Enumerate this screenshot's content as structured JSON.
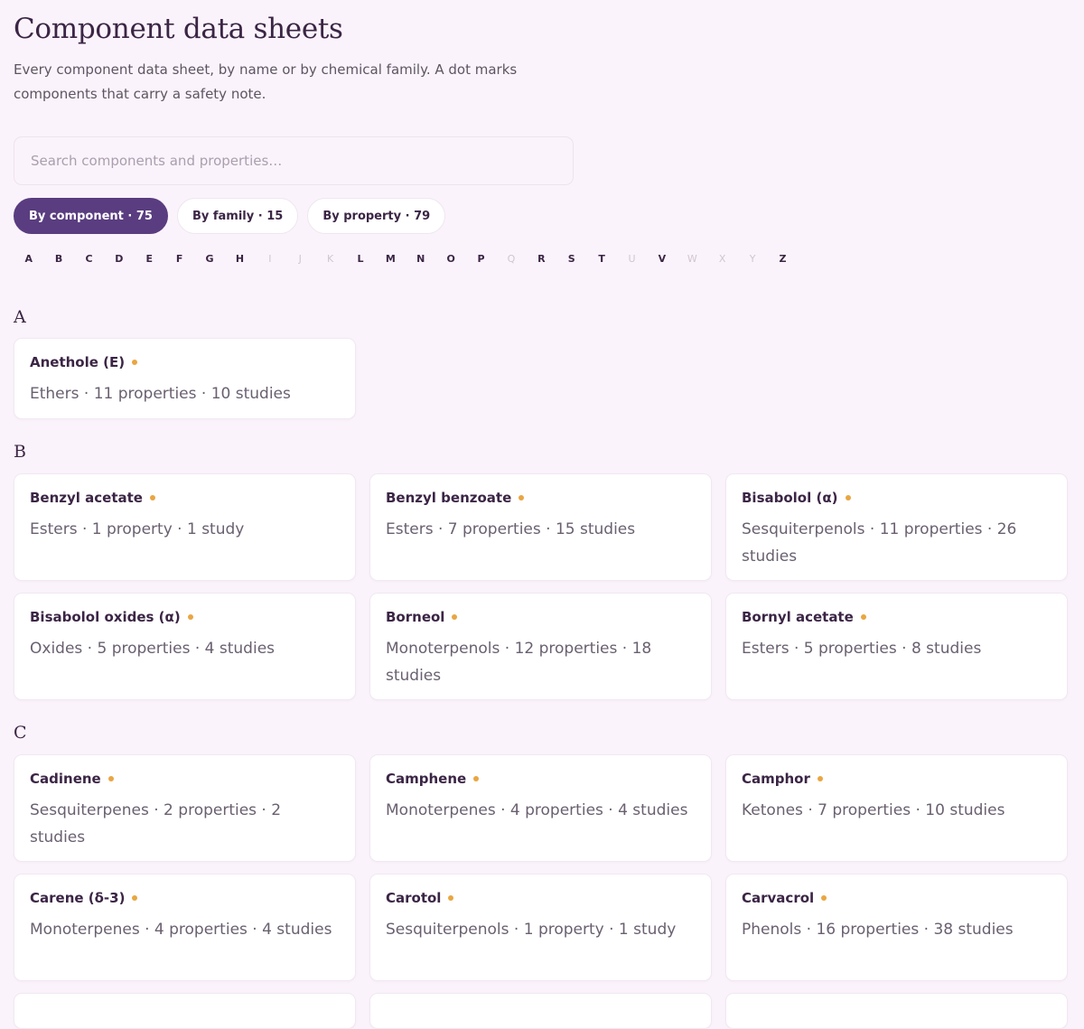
{
  "header": {
    "title": "Component data sheets",
    "subtitle": "Every component data sheet, by name or by chemical family. A dot marks components that carry a safety note."
  },
  "search": {
    "placeholder": "Search components and properties…"
  },
  "tabs": [
    {
      "label": "By component · 75",
      "active": true
    },
    {
      "label": "By family · 15",
      "active": false
    },
    {
      "label": "By property · 79",
      "active": false
    }
  ],
  "alphabet": [
    {
      "letter": "A",
      "enabled": true
    },
    {
      "letter": "B",
      "enabled": true
    },
    {
      "letter": "C",
      "enabled": true
    },
    {
      "letter": "D",
      "enabled": true
    },
    {
      "letter": "E",
      "enabled": true
    },
    {
      "letter": "F",
      "enabled": true
    },
    {
      "letter": "G",
      "enabled": true
    },
    {
      "letter": "H",
      "enabled": true
    },
    {
      "letter": "I",
      "enabled": false
    },
    {
      "letter": "J",
      "enabled": false
    },
    {
      "letter": "K",
      "enabled": false
    },
    {
      "letter": "L",
      "enabled": true
    },
    {
      "letter": "M",
      "enabled": true
    },
    {
      "letter": "N",
      "enabled": true
    },
    {
      "letter": "O",
      "enabled": true
    },
    {
      "letter": "P",
      "enabled": true
    },
    {
      "letter": "Q",
      "enabled": false
    },
    {
      "letter": "R",
      "enabled": true
    },
    {
      "letter": "S",
      "enabled": true
    },
    {
      "letter": "T",
      "enabled": true
    },
    {
      "letter": "U",
      "enabled": false
    },
    {
      "letter": "V",
      "enabled": true
    },
    {
      "letter": "W",
      "enabled": false
    },
    {
      "letter": "X",
      "enabled": false
    },
    {
      "letter": "Y",
      "enabled": false
    },
    {
      "letter": "Z",
      "enabled": true
    }
  ],
  "colors": {
    "accent": "#5a3d80",
    "safety_dot": "#e9a642",
    "background": "#fbf3fb"
  },
  "sections": [
    {
      "letter": "A",
      "items": [
        {
          "name": "Anethole (E)",
          "meta": "Ethers · 11 properties · 10 studies",
          "safety_note": true
        }
      ]
    },
    {
      "letter": "B",
      "items": [
        {
          "name": "Benzyl acetate",
          "meta": "Esters · 1 property · 1 study",
          "safety_note": true
        },
        {
          "name": "Benzyl benzoate",
          "meta": "Esters · 7 properties · 15 studies",
          "safety_note": true
        },
        {
          "name": "Bisabolol (α)",
          "meta": "Sesquiterpenols · 11 properties · 26 studies",
          "safety_note": true
        },
        {
          "name": "Bisabolol oxides (α)",
          "meta": "Oxides · 5 properties · 4 studies",
          "safety_note": true
        },
        {
          "name": "Borneol",
          "meta": "Monoterpenols · 12 properties · 18 studies",
          "safety_note": true
        },
        {
          "name": "Bornyl acetate",
          "meta": "Esters · 5 properties · 8 studies",
          "safety_note": true
        }
      ]
    },
    {
      "letter": "C",
      "items": [
        {
          "name": "Cadinene",
          "meta": "Sesquiterpenes · 2 properties · 2 studies",
          "safety_note": true
        },
        {
          "name": "Camphene",
          "meta": "Monoterpenes · 4 properties · 4 studies",
          "safety_note": true
        },
        {
          "name": "Camphor",
          "meta": "Ketones · 7 properties · 10 studies",
          "safety_note": true
        },
        {
          "name": "Carene (δ-3)",
          "meta": "Monoterpenes · 4 properties · 4 studies",
          "safety_note": true
        },
        {
          "name": "Carotol",
          "meta": "Sesquiterpenols · 1 property · 1 study",
          "safety_note": true
        },
        {
          "name": "Carvacrol",
          "meta": "Phenols · 16 properties · 38 studies",
          "safety_note": true
        }
      ]
    }
  ]
}
